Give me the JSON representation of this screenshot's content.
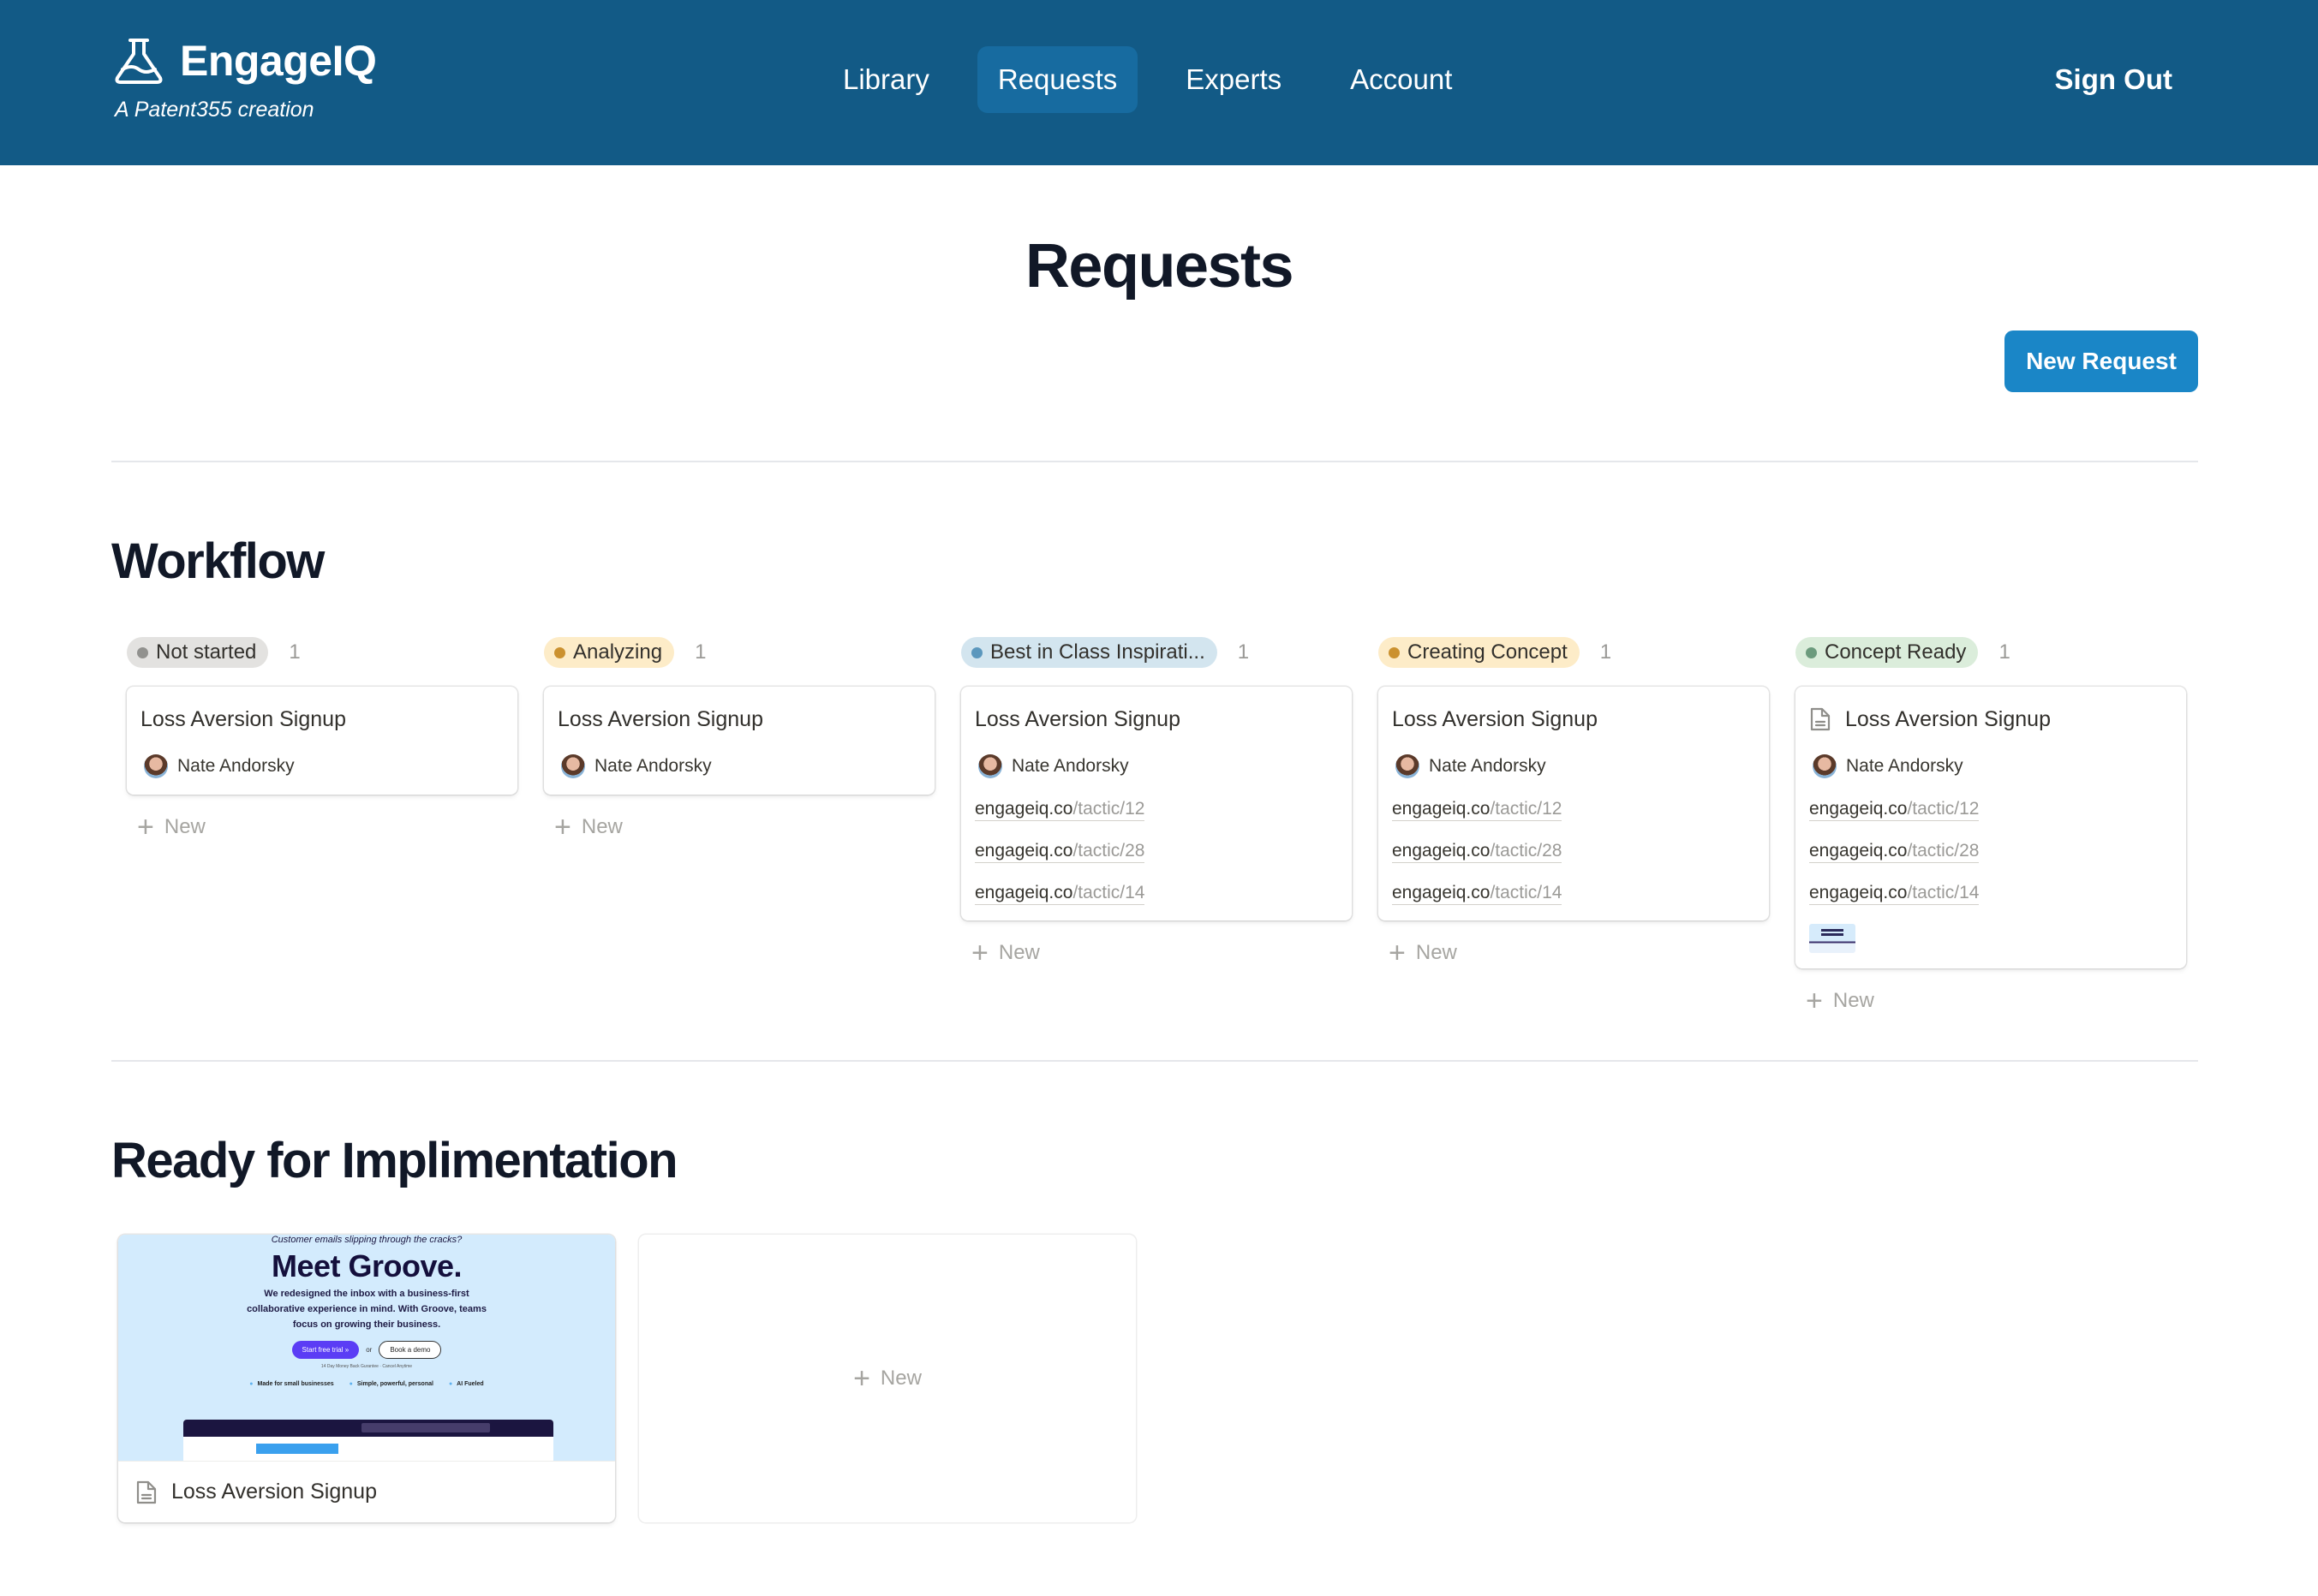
{
  "header": {
    "brand_name": "EngageIQ",
    "brand_subtitle": "A Patent355 creation",
    "nav": [
      {
        "label": "Library",
        "active": false
      },
      {
        "label": "Requests",
        "active": true
      },
      {
        "label": "Experts",
        "active": false
      },
      {
        "label": "Account",
        "active": false
      }
    ],
    "sign_out": "Sign Out",
    "colors": {
      "bar": "#125a86",
      "active_tab": "#176ba0"
    }
  },
  "page": {
    "title": "Requests",
    "new_request_label": "New Request",
    "accent": "#1a86c7"
  },
  "workflow": {
    "title": "Workflow",
    "new_label": "New",
    "columns": [
      {
        "status": "Not started",
        "count": "1",
        "pill_bg": "#e3e2e0",
        "dot": "#91918e",
        "card": {
          "title": "Loss Aversion Signup",
          "has_doc_icon": false,
          "assignee": "Nate Andorsky",
          "links": [],
          "has_thumbnail": false
        }
      },
      {
        "status": "Analyzing",
        "count": "1",
        "pill_bg": "#fdecc8",
        "dot": "#cb912f",
        "card": {
          "title": "Loss Aversion Signup",
          "has_doc_icon": false,
          "assignee": "Nate Andorsky",
          "links": [],
          "has_thumbnail": false
        }
      },
      {
        "status": "Best in Class Inspirati...",
        "count": "1",
        "pill_bg": "#d3e5ef",
        "dot": "#5b97bd",
        "card": {
          "title": "Loss Aversion Signup",
          "has_doc_icon": false,
          "assignee": "Nate Andorsky",
          "links": [
            {
              "domain": "engageiq.co",
              "path": "/tactic/12"
            },
            {
              "domain": "engageiq.co",
              "path": "/tactic/28"
            },
            {
              "domain": "engageiq.co",
              "path": "/tactic/14"
            }
          ],
          "has_thumbnail": false
        }
      },
      {
        "status": "Creating Concept",
        "count": "1",
        "pill_bg": "#fdecc8",
        "dot": "#cb912f",
        "card": {
          "title": "Loss Aversion Signup",
          "has_doc_icon": false,
          "assignee": "Nate Andorsky",
          "links": [
            {
              "domain": "engageiq.co",
              "path": "/tactic/12"
            },
            {
              "domain": "engageiq.co",
              "path": "/tactic/28"
            },
            {
              "domain": "engageiq.co",
              "path": "/tactic/14"
            }
          ],
          "has_thumbnail": false
        }
      },
      {
        "status": "Concept Ready",
        "count": "1",
        "pill_bg": "#dbeddb",
        "dot": "#6c9b7d",
        "card": {
          "title": "Loss Aversion Signup",
          "has_doc_icon": true,
          "assignee": "Nate Andorsky",
          "links": [
            {
              "domain": "engageiq.co",
              "path": "/tactic/12"
            },
            {
              "domain": "engageiq.co",
              "path": "/tactic/28"
            },
            {
              "domain": "engageiq.co",
              "path": "/tactic/14"
            }
          ],
          "has_thumbnail": true
        }
      }
    ]
  },
  "ready": {
    "title": "Ready for Implimentation",
    "new_label": "New",
    "cards": [
      {
        "title": "Loss Aversion Signup",
        "preview": {
          "tagline": "Customer emails slipping through the cracks?",
          "headline": "Meet Groove.",
          "body": "We redesigned the inbox with a business-first collaborative experience in mind. With Groove, teams focus on growing their business.",
          "primary_cta": "Start free trial »",
          "or": "or",
          "secondary_cta": "Book a demo",
          "fineprint": "14 Day Money Back Gurantee · Cancel Anytime",
          "features": [
            "Made for small businesses",
            "Simple, powerful, personal",
            "AI Fueled"
          ]
        }
      }
    ]
  }
}
